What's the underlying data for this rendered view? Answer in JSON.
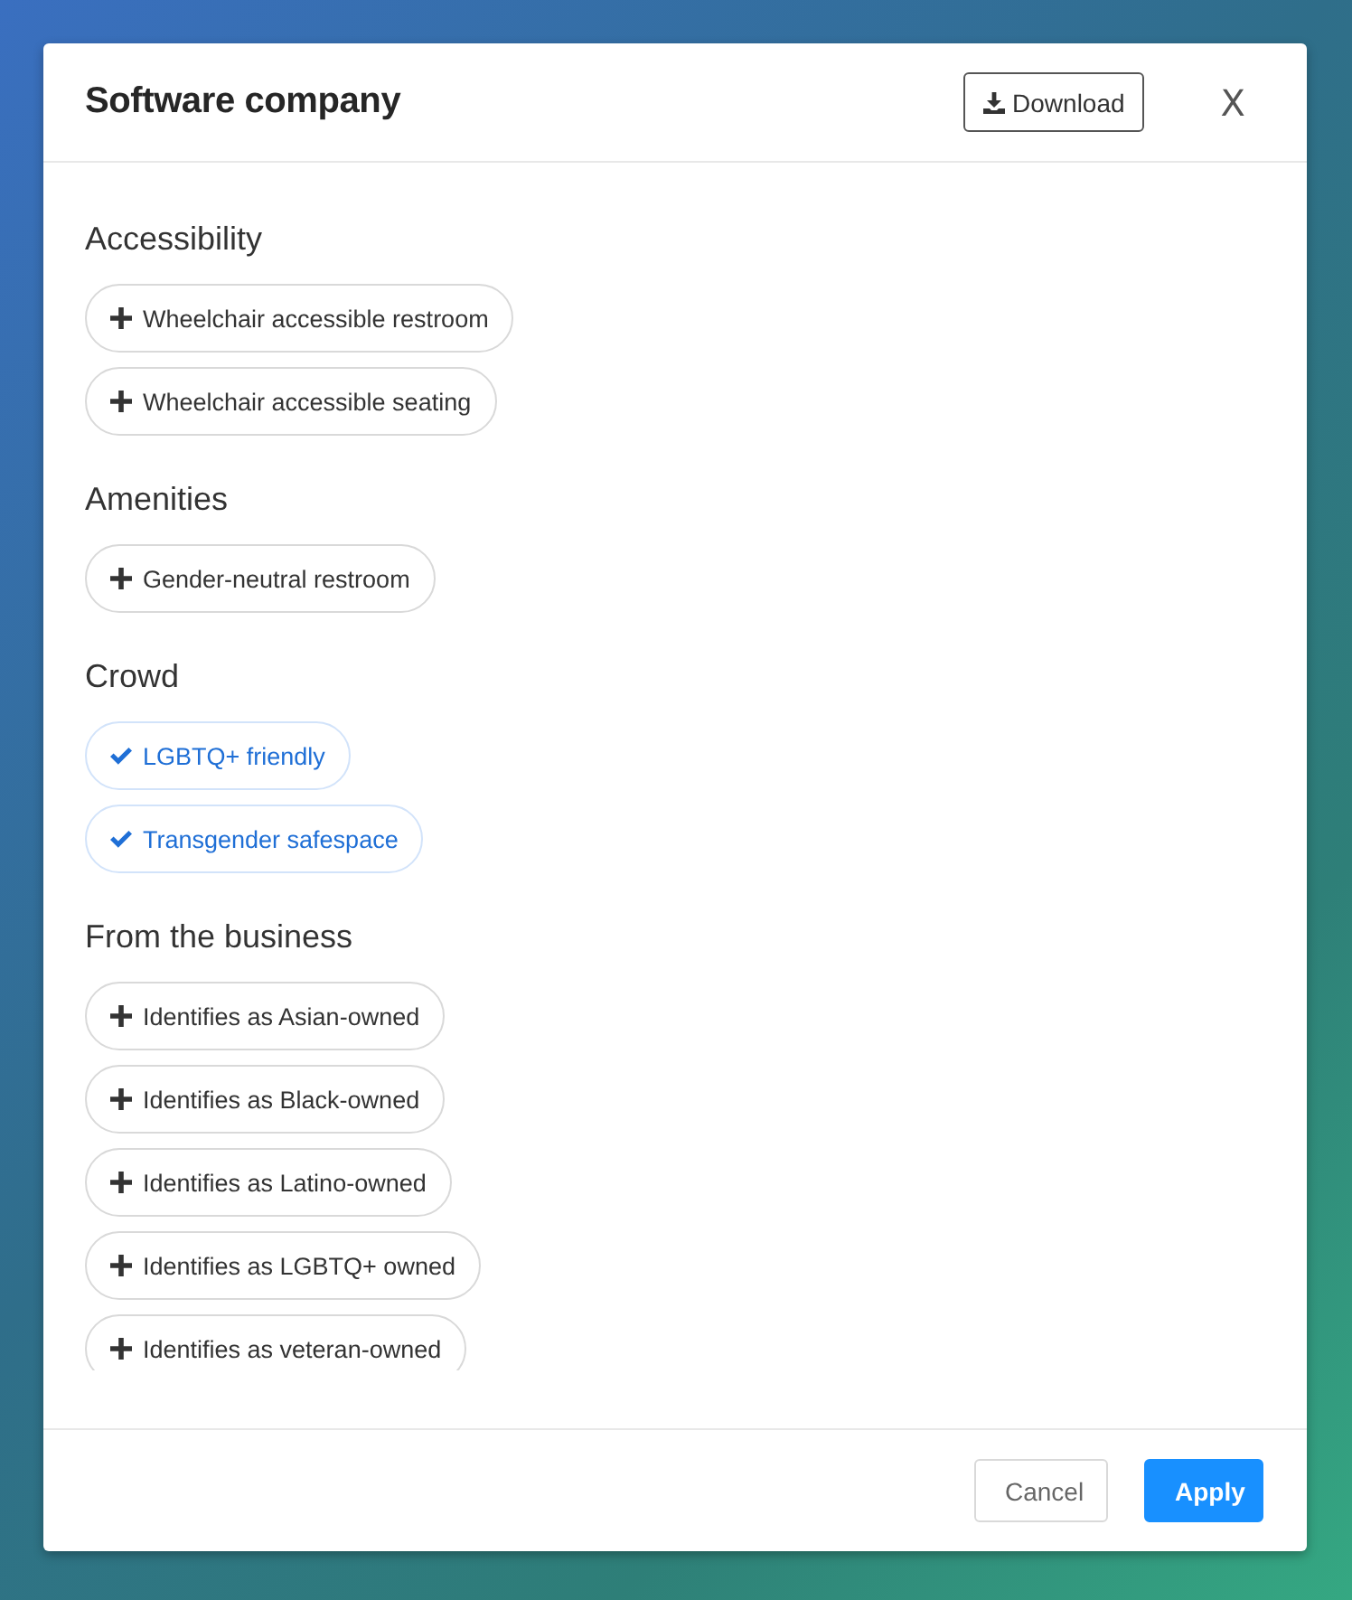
{
  "dialog": {
    "title": "Software company",
    "download_label": "Download",
    "close_label": "X"
  },
  "sections": [
    {
      "title": "Accessibility",
      "items": [
        {
          "label": "Wheelchair accessible restroom",
          "selected": false
        },
        {
          "label": "Wheelchair accessible seating",
          "selected": false
        }
      ]
    },
    {
      "title": "Amenities",
      "items": [
        {
          "label": "Gender-neutral restroom",
          "selected": false
        }
      ]
    },
    {
      "title": "Crowd",
      "items": [
        {
          "label": "LGBTQ+ friendly",
          "selected": true
        },
        {
          "label": "Transgender safespace",
          "selected": true
        }
      ]
    },
    {
      "title": "From the business",
      "items": [
        {
          "label": "Identifies as Asian-owned",
          "selected": false
        },
        {
          "label": "Identifies as Black-owned",
          "selected": false
        },
        {
          "label": "Identifies as Latino-owned",
          "selected": false
        },
        {
          "label": "Identifies as LGBTQ+ owned",
          "selected": false
        },
        {
          "label": "Identifies as veteran-owned",
          "selected": false
        }
      ]
    }
  ],
  "footer_buttons": [
    {
      "label": "Cancel",
      "kind": "secondary"
    },
    {
      "label": "Apply",
      "kind": "primary"
    }
  ]
}
